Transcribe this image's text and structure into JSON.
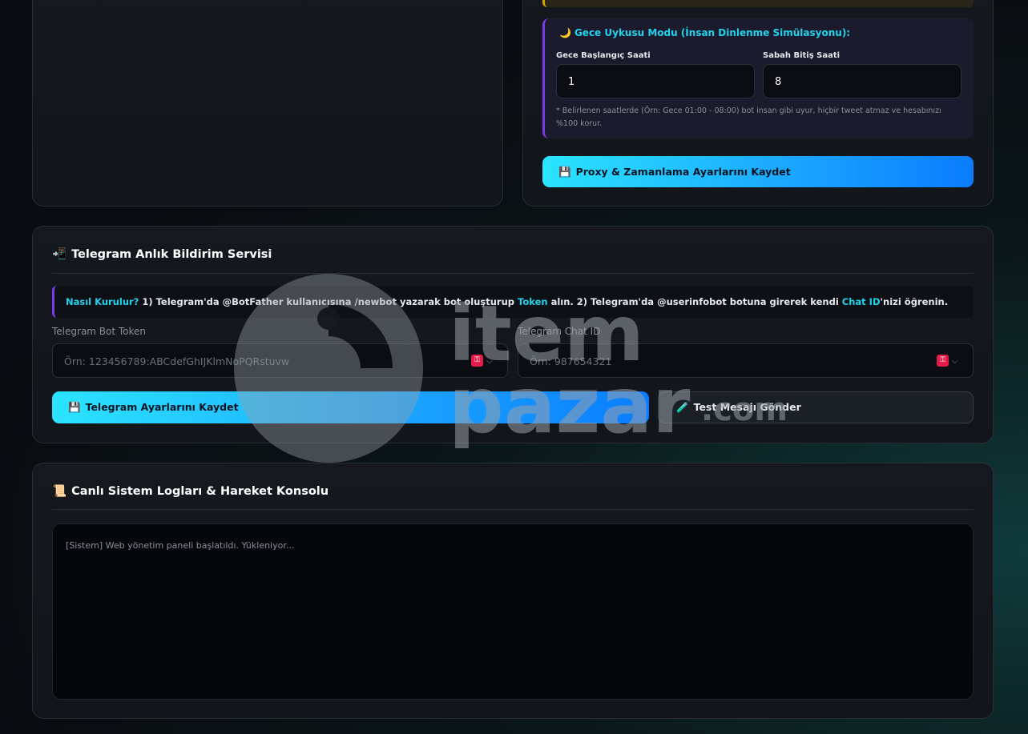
{
  "proxy_card": {
    "sleep_mode": {
      "title_emoji": "🌙",
      "title": "Gece Uykusu Modu (İnsan Dinlenme Simülasyonu):",
      "start_label": "Gece Başlangıç Saati",
      "start_value": "1",
      "end_label": "Sabah Bitiş Saati",
      "end_value": "8",
      "note": "* Belirlenen saatlerde (Örn: Gece 01:00 - 08:00) bot insan gibi uyur, hiçbir tweet atmaz ve hesabınızı %100 korur."
    },
    "save_icon": "💾",
    "save_label": "Proxy & Zamanlama Ayarlarını Kaydet"
  },
  "telegram": {
    "title_icon": "📲",
    "title": "Telegram Anlık Bildirim Servisi",
    "info": {
      "prefix": "Nasıl Kurulur?",
      "part1": " 1) Telegram'da @BotFather kullanıcısına /newbot yazarak bot oluşturup ",
      "token_word": "Token",
      "part2": " alın. 2) Telegram'da @userinfobot botuna girerek kendi ",
      "chatid_word": "Chat ID",
      "part3": "'nizi öğrenin."
    },
    "token_label": "Telegram Bot Token",
    "token_placeholder": "Örn: 123456789:ABCdefGhIJKlmNoPQRstuvw",
    "chat_label": "Telegram Chat ID",
    "chat_placeholder": "Örn: 987654321",
    "save_icon": "💾",
    "save_label": "Telegram Ayarlarını Kaydet",
    "test_icon": "🧪",
    "test_label": "Test Mesajı Gönder"
  },
  "logs": {
    "title_icon": "📜",
    "title": "Canlı Sistem Logları & Hareket Konsolu",
    "lines": [
      "[Sistem] Web yönetim paneli başlatıldı. Yükleniyor..."
    ]
  },
  "watermark": {
    "text_top": "item",
    "text_bottom": "pazar",
    "suffix": ".com"
  },
  "colors": {
    "accent_cyan": "#22d3ee",
    "accent_purple": "#7c3aed",
    "button_gradient_start": "#2be4ff",
    "button_gradient_end": "#0a7dff"
  },
  "icons": {
    "password_manager": "key-icon",
    "dropdown": "chevron-down-icon"
  }
}
